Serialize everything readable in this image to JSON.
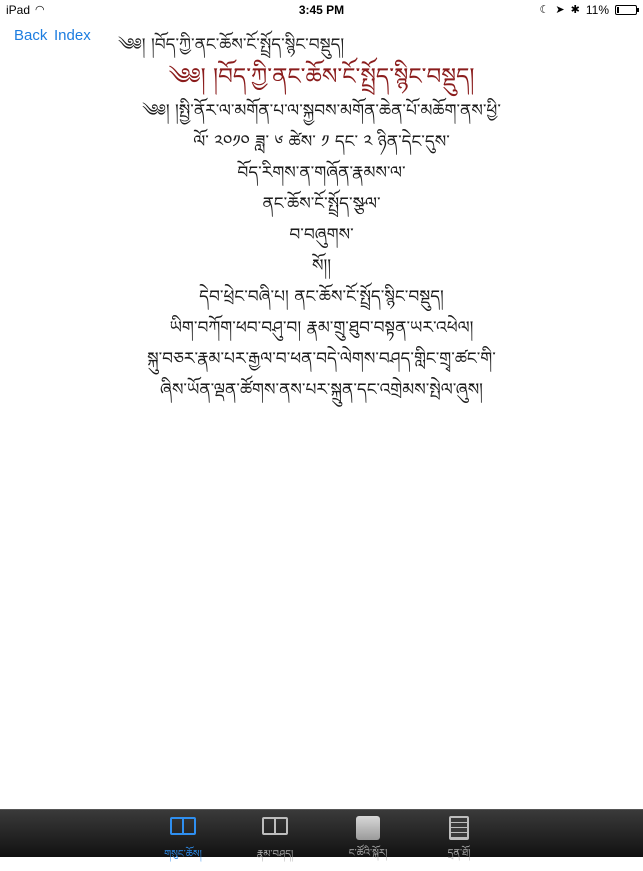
{
  "status_bar": {
    "carrier": "iPad",
    "time": "3:45 PM",
    "battery_text": "11%",
    "battery_level": 0.11,
    "icons": [
      "wifi-icon",
      "moon-icon",
      "location-arrow-icon",
      "bluetooth-icon"
    ]
  },
  "nav": {
    "back_label": "Back",
    "index_label": "Index",
    "title": "༄༅། །བོད་ཀྱི་ནང་ཆོས་ངོ་སྤྲོད་སྙིང་བསྡུད།"
  },
  "content": {
    "heading": "༄༅། །བོད་ཀྱི་ནང་ཆོས་ངོ་སྤྲོད་སྙིང་བསྡུད།",
    "lines": [
      "༄༅། །སྤྱི་ནོར་ལ་མགོན་པ་ལ་སྐྱབས་མགོན་ཆེན་པོ་མཆོག་ནས་ཕྱི་",
      "ལོ་ ༢༠༡༠ ཟླ་ ༦ ཚེས་ ༡ དང་ ༢ ཉིན་དེང་དུས་",
      "བོད་རིགས་ན་གཞོན་རྣམས་ལ་",
      "ནང་ཆོས་ངོ་སྤྲོད་སྩལ་",
      "བ་བཞུགས་",
      "སོ།།",
      "དེབ་ཕྲེང་བཞི་པ། ནང་ཆོས་ངོ་སྤྲོད་སྙིང་བསྡུད།",
      "ཡིག་བཀོག་ཕབ་བཤུ་བ། རྣམ་གྲུ་ཐུབ་བསྟན་ཡར་འཕེལ།",
      "སྐུ་བཅར་རྣམ་པར་རྒྱལ་བ་ཕན་བདེ་ལེགས་བཤད་གླིང་གྲྭ་ཚང་གི་",
      "ཞིས་ཡོན་ལྡན་ཚོགས་ནས་པར་སྐྲུན་དང་འགྲེམས་སྤེལ་ཞུས།"
    ]
  },
  "tabs": [
    {
      "label": "གསུང་ཆོས།",
      "icon": "open-book-icon",
      "active": true
    },
    {
      "label": "རྣམ་བཤད།",
      "icon": "open-book-icon",
      "active": false
    },
    {
      "label": "ང་ཚོའི་སྐོར།",
      "icon": "square-icon",
      "active": false
    },
    {
      "label": "དྲན་ཐོ།",
      "icon": "notebook-icon",
      "active": false
    }
  ],
  "colors": {
    "link": "#1d7de0",
    "heading": "#8a1c1c",
    "tab_active": "#2f8ff0",
    "tab_bar": "#1e1e1e"
  }
}
